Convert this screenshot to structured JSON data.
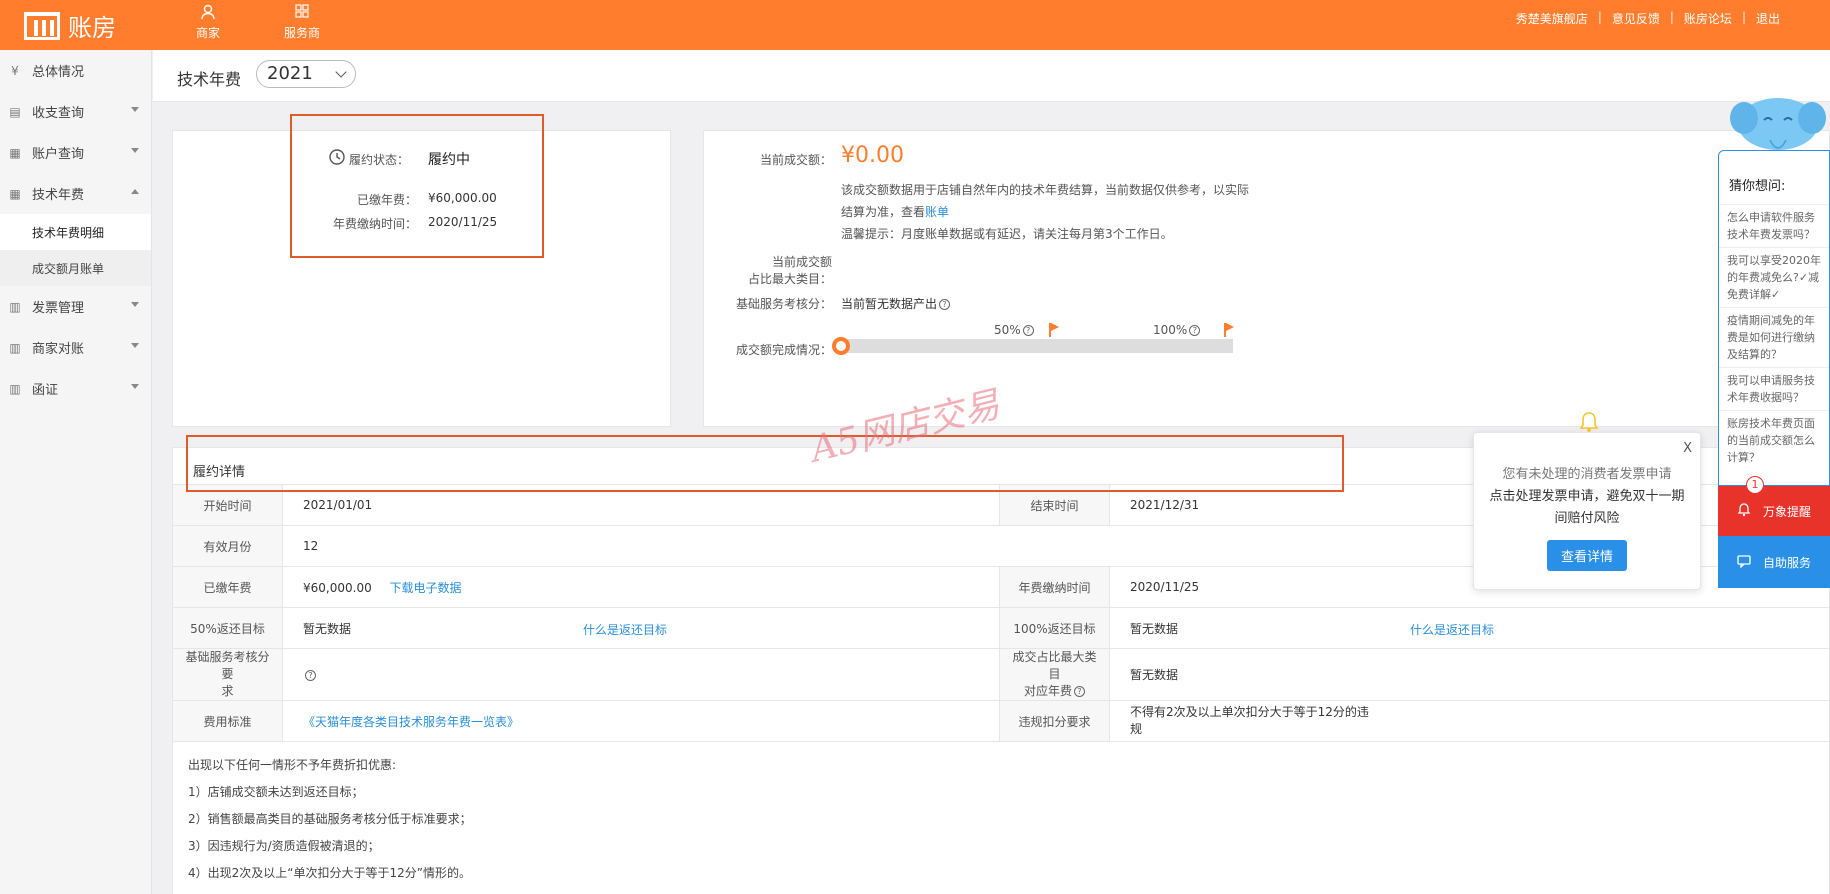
{
  "app": {
    "brand": "账房"
  },
  "topnav": [
    {
      "label": "商家",
      "icon": "user-icon"
    },
    {
      "label": "服务商",
      "icon": "grid-icon"
    }
  ],
  "toplinks": [
    "秀楚美旗舰店",
    "意见反馈",
    "账房论坛",
    "退出"
  ],
  "sidebar": {
    "items": [
      {
        "label": "总体情况",
        "icon": "yen-icon"
      },
      {
        "label": "收支查询",
        "icon": "ledger-icon"
      },
      {
        "label": "账户查询",
        "icon": "table-icon"
      },
      {
        "label": "技术年费",
        "icon": "table-icon"
      },
      {
        "label": "发票管理",
        "icon": "invoice-icon"
      },
      {
        "label": "商家对账",
        "icon": "invoice-icon"
      },
      {
        "label": "函证",
        "icon": "invoice-icon"
      }
    ],
    "subitems": [
      "技术年费明细",
      "成交额月账单"
    ]
  },
  "header": {
    "title": "技术年费",
    "year": "2021"
  },
  "status_card": {
    "status_label": "履约状态：",
    "status_value": "履约中",
    "paid_label": "已缴年费：",
    "paid_value": "¥60,000.00",
    "paytime_label": "年费缴纳时间：",
    "paytime_value": "2020/11/25"
  },
  "turnover_card": {
    "amount_label": "当前成交额：",
    "amount_value": "¥0.00",
    "desc_line1": "该成交额数据用于店铺自然年内的技术年费结算，当前数据仅供参考，以实际",
    "desc_line2_prefix": "结算为准，查看",
    "desc_link": "账单",
    "tip": "温馨提示：月度账单数据或有延迟，请关注每月第3个工作日。",
    "category_label_1": "当前成交额",
    "category_label_2": "占比最大类目：",
    "score_label": "基础服务考核分：",
    "score_value": "当前暂无数据产出",
    "progress_label": "成交额完成情况：",
    "mark_50": "50%",
    "mark_100": "100%",
    "progress": 0
  },
  "detail": {
    "title": "履约详情",
    "start_label": "开始时间",
    "start_value": "2021/01/01",
    "end_label": "结束时间",
    "end_value": "2021/12/31",
    "months_label": "有效月份",
    "months_value": "12",
    "paid_label": "已缴年费",
    "paid_value": "¥60,000.00",
    "paid_link": "下载电子数据",
    "paytime_label": "年费缴纳时间",
    "paytime_value": "2020/11/25",
    "t50_label": "50%返还目标",
    "t50_value": "暂无数据",
    "t50_link": "什么是返还目标",
    "t100_label": "100%返还目标",
    "t100_value": "暂无数据",
    "t100_link": "什么是返还目标",
    "score_req_label_1": "基础服务考核分要",
    "score_req_label_2": "求",
    "cat_fee_label_1": "成交占比最大类目",
    "cat_fee_label_2": "对应年费",
    "cat_fee_value": "暂无数据",
    "fee_std_label": "费用标准",
    "fee_std_link": "《天猫年度各类目技术服务年费一览表》",
    "penalty_label": "违规扣分要求",
    "penalty_value_1": "不得有2次及以上单次扣分大于等于12分的违",
    "penalty_value_2": "规"
  },
  "notes": [
    "出现以下任何一情形不予年费折扣优惠:",
    "1）店铺成交额未达到返还目标；",
    "2）销售额最高类目的基础服务考核分低于标准要求；",
    "3）因违规行为/资质造假被清退的；",
    "4）出现2次及以上“单次扣分大于等于12分”情形的。"
  ],
  "watermark": "A5网店交易",
  "popup": {
    "line1": "您有未处理的消费者发票申请",
    "line2": "点击处理发票申请，避免双十一期间赔付风险",
    "button": "查看详情",
    "close": "X"
  },
  "assistant": {
    "title": "猜你想问:",
    "questions": [
      "怎么申请软件服务技术年费发票吗？",
      "我可以享受2020年的年费减免么?✓减免费详解✓",
      "疫情期间减免的年费是如何进行缴纳及结算的？",
      "我可以申请服务技术年费收据吗？",
      "账房技术年费页面的当前成交额怎么计算？"
    ],
    "alert_label": "万象提醒",
    "alert_count": "1",
    "self_service": "自助服务"
  },
  "colors": {
    "brand": "#ff7d2d",
    "link": "#2a8fd6",
    "highlight": "#e05a2a",
    "alert": "#e8332b",
    "primary": "#2a8fe6"
  }
}
